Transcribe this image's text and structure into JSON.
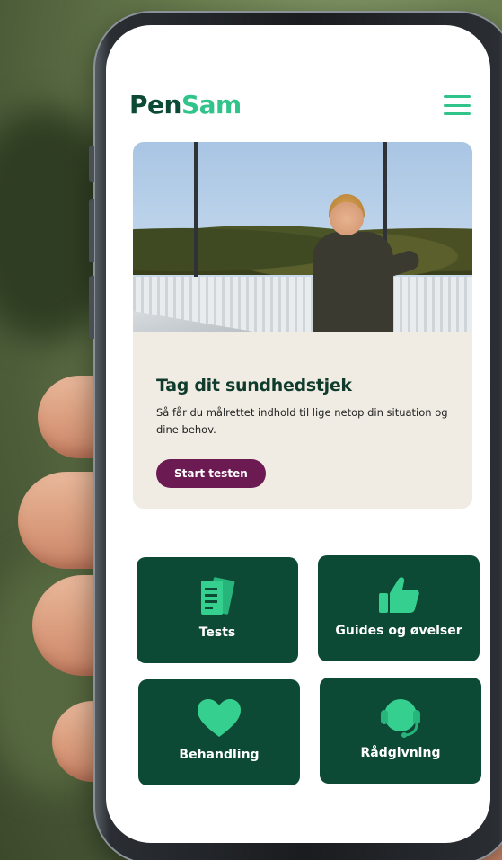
{
  "app": {
    "brand_part1": "Pen",
    "brand_part2": "Sam",
    "colors": {
      "brand_dark": "#0d4a35",
      "brand_accent": "#30c48a",
      "cta": "#6b1a52",
      "card_bg": "#f0ebe3"
    }
  },
  "header": {
    "menu_icon": "hamburger-menu-icon"
  },
  "hero": {
    "title": "Tag dit sundhedstjek",
    "text": "Så får du målrettet indhold til lige netop din situation og dine behov.",
    "cta_label": "Start testen"
  },
  "tiles": [
    {
      "label": "Tests",
      "icon": "documents-icon"
    },
    {
      "label": "Guides og øvelser",
      "icon": "thumbs-up-icon"
    },
    {
      "label": "Behandling",
      "icon": "heart-icon"
    },
    {
      "label": "Rådgivning",
      "icon": "headset-icon"
    }
  ]
}
